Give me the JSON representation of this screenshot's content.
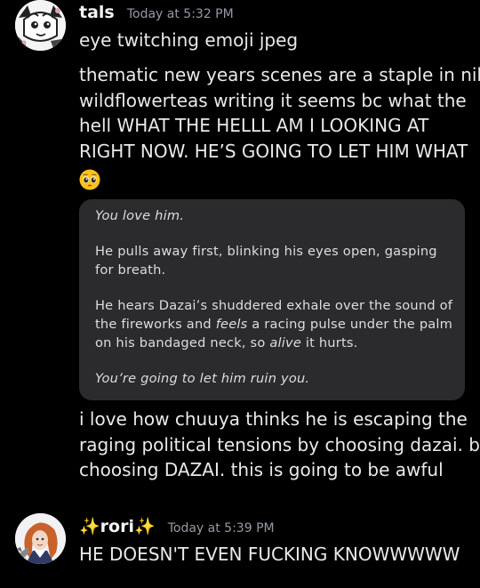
{
  "messages": [
    {
      "author": "tals",
      "timestamp": "Today at 5:32 PM",
      "avatar_icon": "manga-character-avatar",
      "text_lines": [
        "eye twitching emoji jpeg",
        "thematic new years scenes are a staple in niko",
        "wildflowerteas writing it seems bc what the",
        "hell WHAT THE HELLL AM I LOOKING AT",
        "RIGHT NOW. HE’S GOING TO LET HIM WHAT"
      ],
      "emoji": "pleading-face-emoji",
      "quote": {
        "line1": "You love him.",
        "line2": "He pulls away first, blinking his eyes open, gasping",
        "line3": "for breath.",
        "line4": "He hears Dazai’s shuddered exhale over the sound of",
        "line5_a": "the fireworks and ",
        "line5_b": "feels",
        "line5_c": " a racing pulse under the palm",
        "line6_a": "on his bandaged neck, so ",
        "line6_b": "alive",
        "line6_c": " it hurts.",
        "line7": "You’re going to let him ruin you."
      },
      "after_lines": [
        "i love how chuuya thinks he is escaping the",
        "raging political tensions by choosing dazai. by",
        "choosing DAZAI. this is going to be awful"
      ]
    },
    {
      "author": "✨rori✨",
      "timestamp": "Today at 5:39 PM",
      "avatar_icon": "orange-haired-character-avatar",
      "text": "HE DOESN'T EVEN FUCKING KNOWWWWW"
    }
  ],
  "colors": {
    "background": "#000000",
    "text": "#e9e9ec",
    "timestamp": "#949ba4",
    "quote_bg": "#2b2b2e",
    "sparkle": "#f7c948"
  }
}
